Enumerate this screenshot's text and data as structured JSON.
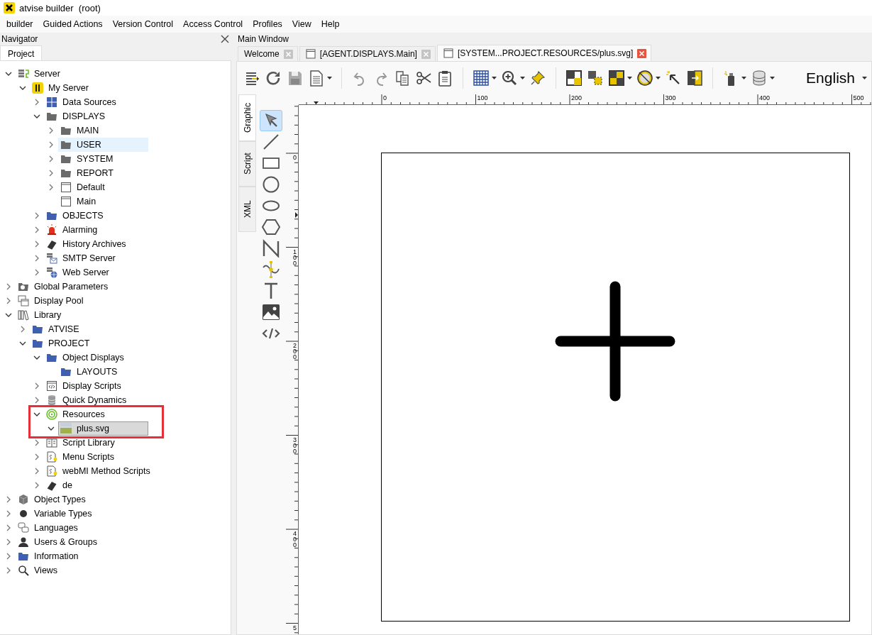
{
  "window": {
    "title": "atvise builder  (root)"
  },
  "menu": [
    "builder",
    "Guided Actions",
    "Version Control",
    "Access Control",
    "Profiles",
    "View",
    "Help"
  ],
  "navigator": {
    "title": "Navigator",
    "tabs": [
      {
        "label": "Project",
        "selected": true
      }
    ],
    "tree": [
      {
        "label": "Server",
        "kind": "servers",
        "expanded": true,
        "selected": false,
        "children": [
          {
            "label": "My Server",
            "kind": "badge",
            "expanded": true,
            "selected": false,
            "children": [
              {
                "label": "Data Sources",
                "kind": "grid",
                "expanded": false,
                "selected": false
              },
              {
                "label": "DISPLAYS",
                "kind": "folder",
                "expanded": true,
                "selected": false,
                "children": [
                  {
                    "label": "MAIN",
                    "kind": "folder",
                    "expanded": false,
                    "selected": false
                  },
                  {
                    "label": "USER",
                    "kind": "folder",
                    "expanded": false,
                    "selected": false,
                    "hovered": true
                  },
                  {
                    "label": "SYSTEM",
                    "kind": "folder",
                    "expanded": false,
                    "selected": false
                  },
                  {
                    "label": "REPORT",
                    "kind": "folder",
                    "expanded": false,
                    "selected": false
                  },
                  {
                    "label": "Default",
                    "kind": "window",
                    "expanded": false,
                    "selected": false
                  },
                  {
                    "label": "Main",
                    "kind": "window",
                    "selected": false
                  }
                ]
              },
              {
                "label": "OBJECTS",
                "kind": "bluefolder",
                "expanded": false,
                "selected": false
              },
              {
                "label": "Alarming",
                "kind": "alarm",
                "expanded": false,
                "selected": false
              },
              {
                "label": "History Archives",
                "kind": "book",
                "expanded": false,
                "selected": false
              },
              {
                "label": "SMTP Server",
                "kind": "mail",
                "expanded": false,
                "selected": false
              },
              {
                "label": "Web Server",
                "kind": "globe",
                "expanded": false,
                "selected": false
              }
            ]
          }
        ]
      },
      {
        "label": "Global Parameters",
        "kind": "camera",
        "expanded": false,
        "selected": false
      },
      {
        "label": "Display Pool",
        "kind": "pool",
        "expanded": false,
        "selected": false
      },
      {
        "label": "Library",
        "kind": "books",
        "expanded": true,
        "selected": false,
        "children": [
          {
            "label": "ATVISE",
            "kind": "bluefolder",
            "expanded": false,
            "selected": false
          },
          {
            "label": "PROJECT",
            "kind": "bluefolder",
            "expanded": true,
            "selected": false,
            "children": [
              {
                "label": "Object Displays",
                "kind": "bluefolder",
                "expanded": true,
                "selected": false,
                "children": [
                  {
                    "label": "LAYOUTS",
                    "kind": "bluefolder",
                    "selected": false
                  }
                ]
              },
              {
                "label": "Display Scripts",
                "kind": "code",
                "expanded": false,
                "selected": false
              },
              {
                "label": "Quick Dynamics",
                "kind": "cylinder",
                "expanded": false,
                "selected": false
              },
              {
                "label": "Resources",
                "kind": "spiral",
                "expanded": true,
                "selected": false,
                "framed": true,
                "children": [
                  {
                    "label": "plus.svg",
                    "kind": "svgfile",
                    "expanded": true,
                    "selected": true
                  }
                ]
              },
              {
                "label": "Script Library",
                "kind": "scriptlib",
                "expanded": false,
                "selected": false
              },
              {
                "label": "Menu Scripts",
                "kind": "script",
                "expanded": false,
                "selected": false
              },
              {
                "label": "webMI Method Scripts",
                "kind": "script",
                "expanded": false,
                "selected": false
              },
              {
                "label": "de",
                "kind": "book",
                "expanded": false,
                "selected": false
              }
            ]
          }
        ]
      },
      {
        "label": "Object Types",
        "kind": "cube",
        "expanded": false,
        "selected": false
      },
      {
        "label": "Variable Types",
        "kind": "dot",
        "expanded": false,
        "selected": false
      },
      {
        "label": "Languages",
        "kind": "languages",
        "expanded": false,
        "selected": false
      },
      {
        "label": "Users & Groups",
        "kind": "user",
        "expanded": false,
        "selected": false
      },
      {
        "label": "Information",
        "kind": "bluefolder",
        "expanded": false,
        "selected": false
      },
      {
        "label": "Views",
        "kind": "search",
        "expanded": false,
        "selected": false
      }
    ]
  },
  "main_window": {
    "title": "Main Window",
    "tabs": [
      {
        "label": "Welcome",
        "selected": false,
        "kind": "page"
      },
      {
        "label": "[AGENT.DISPLAYS.Main]",
        "selected": false,
        "kind": "display"
      },
      {
        "label": "[SYSTEM...PROJECT.RESOURCES/plus.svg]",
        "selected": true,
        "kind": "display"
      }
    ],
    "language": "English",
    "side_tabs": [
      {
        "label": "Graphic",
        "selected": true
      },
      {
        "label": "Script",
        "selected": false
      },
      {
        "label": "XML",
        "selected": false
      }
    ],
    "tools": [
      {
        "kind": "pointer",
        "selected": true
      },
      {
        "kind": "line",
        "selected": false
      },
      {
        "kind": "rect",
        "selected": false
      },
      {
        "kind": "circle",
        "selected": false
      },
      {
        "kind": "ellipse",
        "selected": false
      },
      {
        "kind": "polygon",
        "selected": false
      },
      {
        "kind": "polyline",
        "selected": false
      },
      {
        "kind": "path",
        "selected": false
      },
      {
        "kind": "text",
        "selected": false
      },
      {
        "kind": "image",
        "selected": false
      },
      {
        "kind": "code",
        "selected": false
      }
    ],
    "h_ruler": [
      "0",
      "100",
      "200",
      "300",
      "400",
      "500"
    ],
    "v_ruler": [
      "0",
      "100",
      "200",
      "300",
      "400",
      "5"
    ]
  }
}
